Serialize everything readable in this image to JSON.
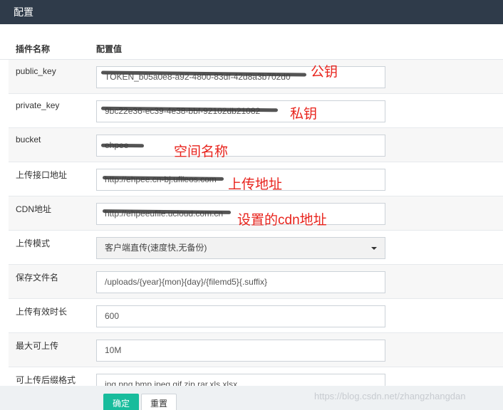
{
  "window": {
    "title": "配置"
  },
  "table": {
    "col_name": "插件名称",
    "col_value": "配置值"
  },
  "rows": [
    {
      "label": "public_key",
      "value": "TOKEN_b05a0e8-a92-4800-83df-42d8a3b702d0"
    },
    {
      "label": "private_key",
      "value": "9bc22e36-ec39-4e38-bbf-92102db21082"
    },
    {
      "label": "bucket",
      "value": "ehpee"
    },
    {
      "label": "上传接口地址",
      "value": "http://ehpee.cn-bj.ufileos.com"
    },
    {
      "label": "CDN地址",
      "value": "http://ehpeeufile.ucloud.com.cn"
    },
    {
      "label": "上传模式",
      "value": "客户端直传(速度快,无备份)"
    },
    {
      "label": "保存文件名",
      "value": "/uploads/{year}{mon}{day}/{filemd5}{.suffix}"
    },
    {
      "label": "上传有效时长",
      "value": "600"
    },
    {
      "label": "最大可上传",
      "value": "10M"
    },
    {
      "label": "可上传后缀格式",
      "value": "jpg,png,bmp,jpeg,gif,zip,rar,xls,xlsx"
    }
  ],
  "annotations": {
    "public_key": "公钥",
    "private_key": "私钥",
    "bucket": "空间名称",
    "upload_url": "上传地址",
    "cdn": "设置的cdn地址"
  },
  "buttons": {
    "ok": "确定",
    "reset": "重置"
  },
  "watermark": "https://blog.csdn.net/zhangzhangdan",
  "colors": {
    "topbar": "#2f3b4a",
    "primary_button": "#18bc9c",
    "annotation": "#e8231c"
  }
}
